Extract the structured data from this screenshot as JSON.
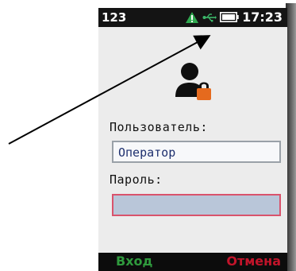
{
  "statusbar": {
    "left_text": "123",
    "time": "17:23",
    "icons": [
      "warning-icon",
      "usb-icon",
      "battery-icon"
    ]
  },
  "login": {
    "user_label": "Пользователь:",
    "user_value": "Оператор",
    "password_label": "Пароль:",
    "password_value": ""
  },
  "softkeys": {
    "left": "Вход",
    "right": "Отмена"
  },
  "colors": {
    "screen_bg": "#ececec",
    "softkey_left": "#2f9a3d",
    "softkey_right": "#c2142a",
    "warning": "#2fa84f",
    "lock": "#e56a1e",
    "password_border": "#d9536c"
  }
}
